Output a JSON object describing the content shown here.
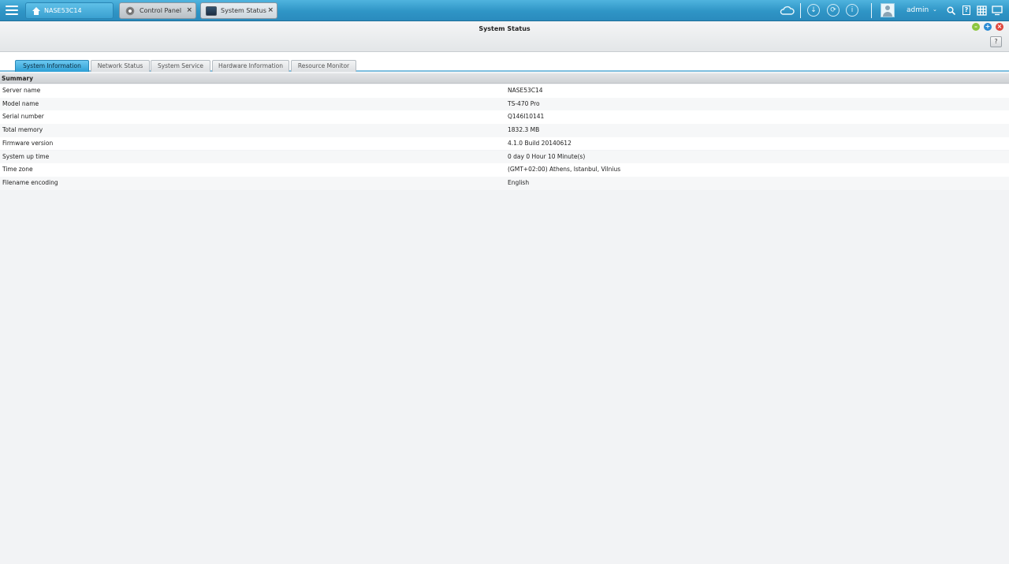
{
  "taskbar": {
    "home_tab_label": "NASE53C14",
    "tabs": [
      {
        "label": "Control Panel",
        "close": "×"
      },
      {
        "label": "System Status",
        "close": "×"
      }
    ],
    "tray_icons": [
      "cloud-icon",
      "download-icon",
      "sync-icon",
      "info-icon",
      "search-icon",
      "help-icon",
      "grid-icon",
      "desktop-icon"
    ],
    "user_label": "admin"
  },
  "window": {
    "title": "System Status",
    "help_label": "?"
  },
  "subtabs": [
    {
      "label": "System Information",
      "active": true
    },
    {
      "label": "Network Status"
    },
    {
      "label": "System Service"
    },
    {
      "label": "Hardware Information"
    },
    {
      "label": "Resource Monitor"
    }
  ],
  "summary": {
    "header": "Summary",
    "rows": [
      {
        "key": "Server name",
        "value": "NASE53C14"
      },
      {
        "key": "Model name",
        "value": "TS-470 Pro"
      },
      {
        "key": "Serial number",
        "value": "Q146I10141"
      },
      {
        "key": "Total memory",
        "value": "1832.3 MB"
      },
      {
        "key": "Firmware version",
        "value": "4.1.0 Build 20140612"
      },
      {
        "key": "System up time",
        "value": "0 day 0 Hour 10 Minute(s)"
      },
      {
        "key": "Time zone",
        "value": "(GMT+02:00) Athens, Istanbul, Vilnius"
      },
      {
        "key": "Filename encoding",
        "value": "English"
      }
    ]
  },
  "colors": {
    "taskbar": "#2f95c6",
    "active_tab": "#2ea0d6",
    "minimize": "#8cc63f",
    "maximize": "#2a8ad4",
    "close": "#e0463c"
  }
}
